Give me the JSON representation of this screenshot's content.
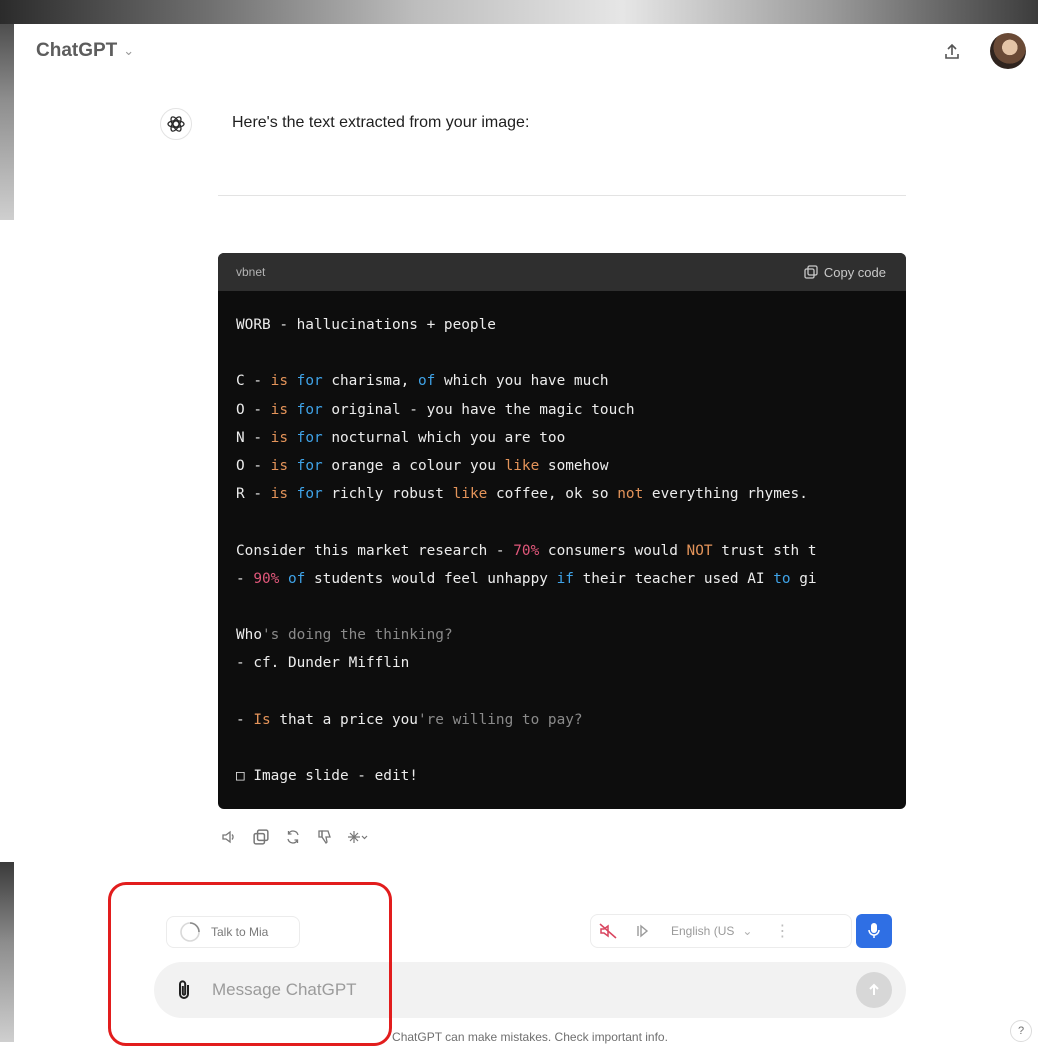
{
  "header": {
    "model_name": "ChatGPT"
  },
  "message": {
    "intro": "Here's the text extracted from your image:"
  },
  "code_block": {
    "language": "vbnet",
    "copy_label": "Copy code",
    "lines": [
      [
        {
          "t": "WORB - hallucinations + people"
        }
      ],
      [
        {
          "t": ""
        }
      ],
      [
        {
          "t": "C - "
        },
        {
          "t": "is",
          "c": "kw"
        },
        {
          "t": " "
        },
        {
          "t": "for",
          "c": "blue"
        },
        {
          "t": " charisma, "
        },
        {
          "t": "of",
          "c": "blue"
        },
        {
          "t": " which you have much"
        }
      ],
      [
        {
          "t": "O - "
        },
        {
          "t": "is",
          "c": "kw"
        },
        {
          "t": " "
        },
        {
          "t": "for",
          "c": "blue"
        },
        {
          "t": " original - you have the magic touch"
        }
      ],
      [
        {
          "t": "N - "
        },
        {
          "t": "is",
          "c": "kw"
        },
        {
          "t": " "
        },
        {
          "t": "for",
          "c": "blue"
        },
        {
          "t": " nocturnal which you are too"
        }
      ],
      [
        {
          "t": "O - "
        },
        {
          "t": "is",
          "c": "kw"
        },
        {
          "t": " "
        },
        {
          "t": "for",
          "c": "blue"
        },
        {
          "t": " orange a colour you "
        },
        {
          "t": "like",
          "c": "kw"
        },
        {
          "t": " somehow"
        }
      ],
      [
        {
          "t": "R - "
        },
        {
          "t": "is",
          "c": "kw"
        },
        {
          "t": " "
        },
        {
          "t": "for",
          "c": "blue"
        },
        {
          "t": " richly robust "
        },
        {
          "t": "like",
          "c": "kw"
        },
        {
          "t": " coffee, ok so "
        },
        {
          "t": "not",
          "c": "kw"
        },
        {
          "t": " everything rhymes."
        }
      ],
      [
        {
          "t": ""
        }
      ],
      [
        {
          "t": "Consider this market research - "
        },
        {
          "t": "70%",
          "c": "num"
        },
        {
          "t": " consumers would "
        },
        {
          "t": "NOT",
          "c": "kw"
        },
        {
          "t": " trust sth t"
        }
      ],
      [
        {
          "t": "- "
        },
        {
          "t": "90%",
          "c": "num"
        },
        {
          "t": " "
        },
        {
          "t": "of",
          "c": "blue"
        },
        {
          "t": " students would feel unhappy "
        },
        {
          "t": "if",
          "c": "blue"
        },
        {
          "t": " their teacher used AI "
        },
        {
          "t": "to",
          "c": "blue"
        },
        {
          "t": " gi"
        }
      ],
      [
        {
          "t": ""
        }
      ],
      [
        {
          "t": "Who"
        },
        {
          "t": "'s doing the thinking?",
          "c": "dim"
        }
      ],
      [
        {
          "t": "- cf. Dunder Mifflin"
        }
      ],
      [
        {
          "t": ""
        }
      ],
      [
        {
          "t": "- "
        },
        {
          "t": "Is",
          "c": "kw"
        },
        {
          "t": " that a price you"
        },
        {
          "t": "'re willing to pay?",
          "c": "dim"
        }
      ],
      [
        {
          "t": ""
        }
      ],
      [
        {
          "t": "□ Image slide - edit!"
        }
      ]
    ]
  },
  "voice": {
    "talk_label": "Talk to Mia",
    "language": "English (US"
  },
  "composer": {
    "placeholder": "Message ChatGPT"
  },
  "footer": {
    "disclaimer": "ChatGPT can make mistakes. Check important info.",
    "help": "?"
  },
  "colors": {
    "accent": "#2f6fe4",
    "highlight": "#e21d1d",
    "code_bg": "#0d0d0d"
  }
}
